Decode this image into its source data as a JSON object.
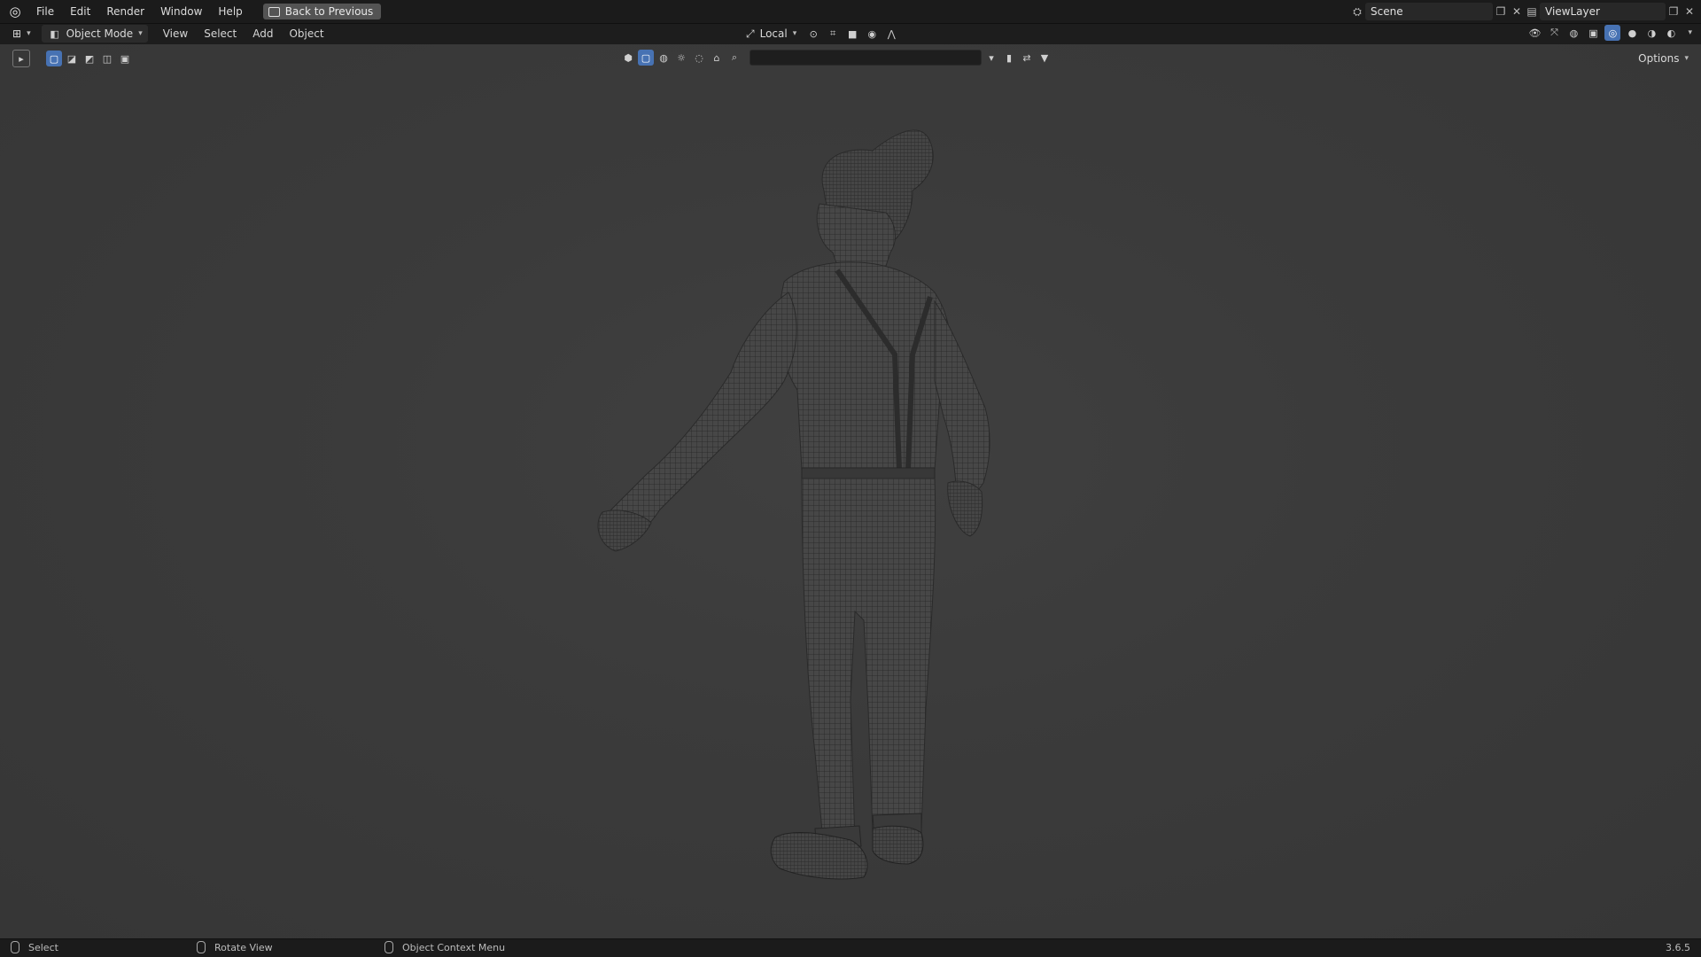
{
  "app": {
    "menu": [
      "File",
      "Edit",
      "Render",
      "Window",
      "Help"
    ],
    "back_button": "Back to Previous",
    "scene_name": "Scene",
    "view_layer": "ViewLayer"
  },
  "header": {
    "mode": "Object Mode",
    "menus": [
      "View",
      "Select",
      "Add",
      "Object"
    ],
    "pivot": "Local",
    "options_label": "Options"
  },
  "status": {
    "left": "Select",
    "middle": "Rotate View",
    "right": "Object Context Menu",
    "version": "3.6.5"
  },
  "colors": {
    "accent": "#4772b3",
    "viewport": "#3c3c3c",
    "wire": "#2a2a2a"
  }
}
